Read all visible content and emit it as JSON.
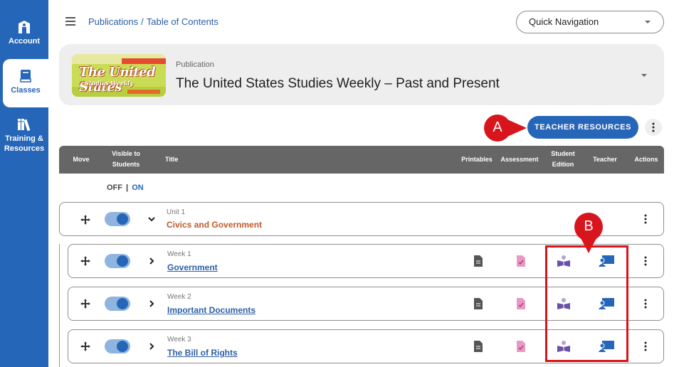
{
  "sidebar": {
    "items": [
      {
        "label": "Account",
        "icon": "account-icon",
        "active": false
      },
      {
        "label": "Classes",
        "icon": "classes-icon",
        "active": true
      },
      {
        "label": "Training & Resources",
        "icon": "training-icon",
        "active": false
      }
    ]
  },
  "header": {
    "breadcrumb": [
      "Publications",
      "Table of Contents"
    ],
    "breadcrumb_sep": "/",
    "quick_nav": "Quick Navigation"
  },
  "publication": {
    "label": "Publication",
    "title": "The United States Studies Weekly – Past and Present",
    "thumb_logo": "The United States",
    "thumb_sub": "Studies Weekly"
  },
  "actions": {
    "teacher_resources": "TEACHER RESOURCES"
  },
  "callouts": {
    "a": "A",
    "b": "B"
  },
  "table": {
    "headers": {
      "move": "Move",
      "visible": "Visible to Students",
      "title": "Title",
      "printables": "Printables",
      "assessment": "Assessment",
      "student_edition": "Student Edition",
      "teacher": "Teacher",
      "actions": "Actions"
    },
    "off_label": "OFF",
    "on_label": "ON",
    "unit": {
      "label": "Unit 1",
      "title": "Civics and Government",
      "visible": true
    },
    "weeks": [
      {
        "label": "Week 1",
        "title": "Government",
        "visible": true
      },
      {
        "label": "Week 2",
        "title": "Important Documents",
        "visible": true
      },
      {
        "label": "Week 3",
        "title": "The Bill of Rights",
        "visible": true
      }
    ]
  },
  "colors": {
    "brand": "#2666b8",
    "callout": "#d8141c",
    "unit_title": "#c0592a"
  }
}
